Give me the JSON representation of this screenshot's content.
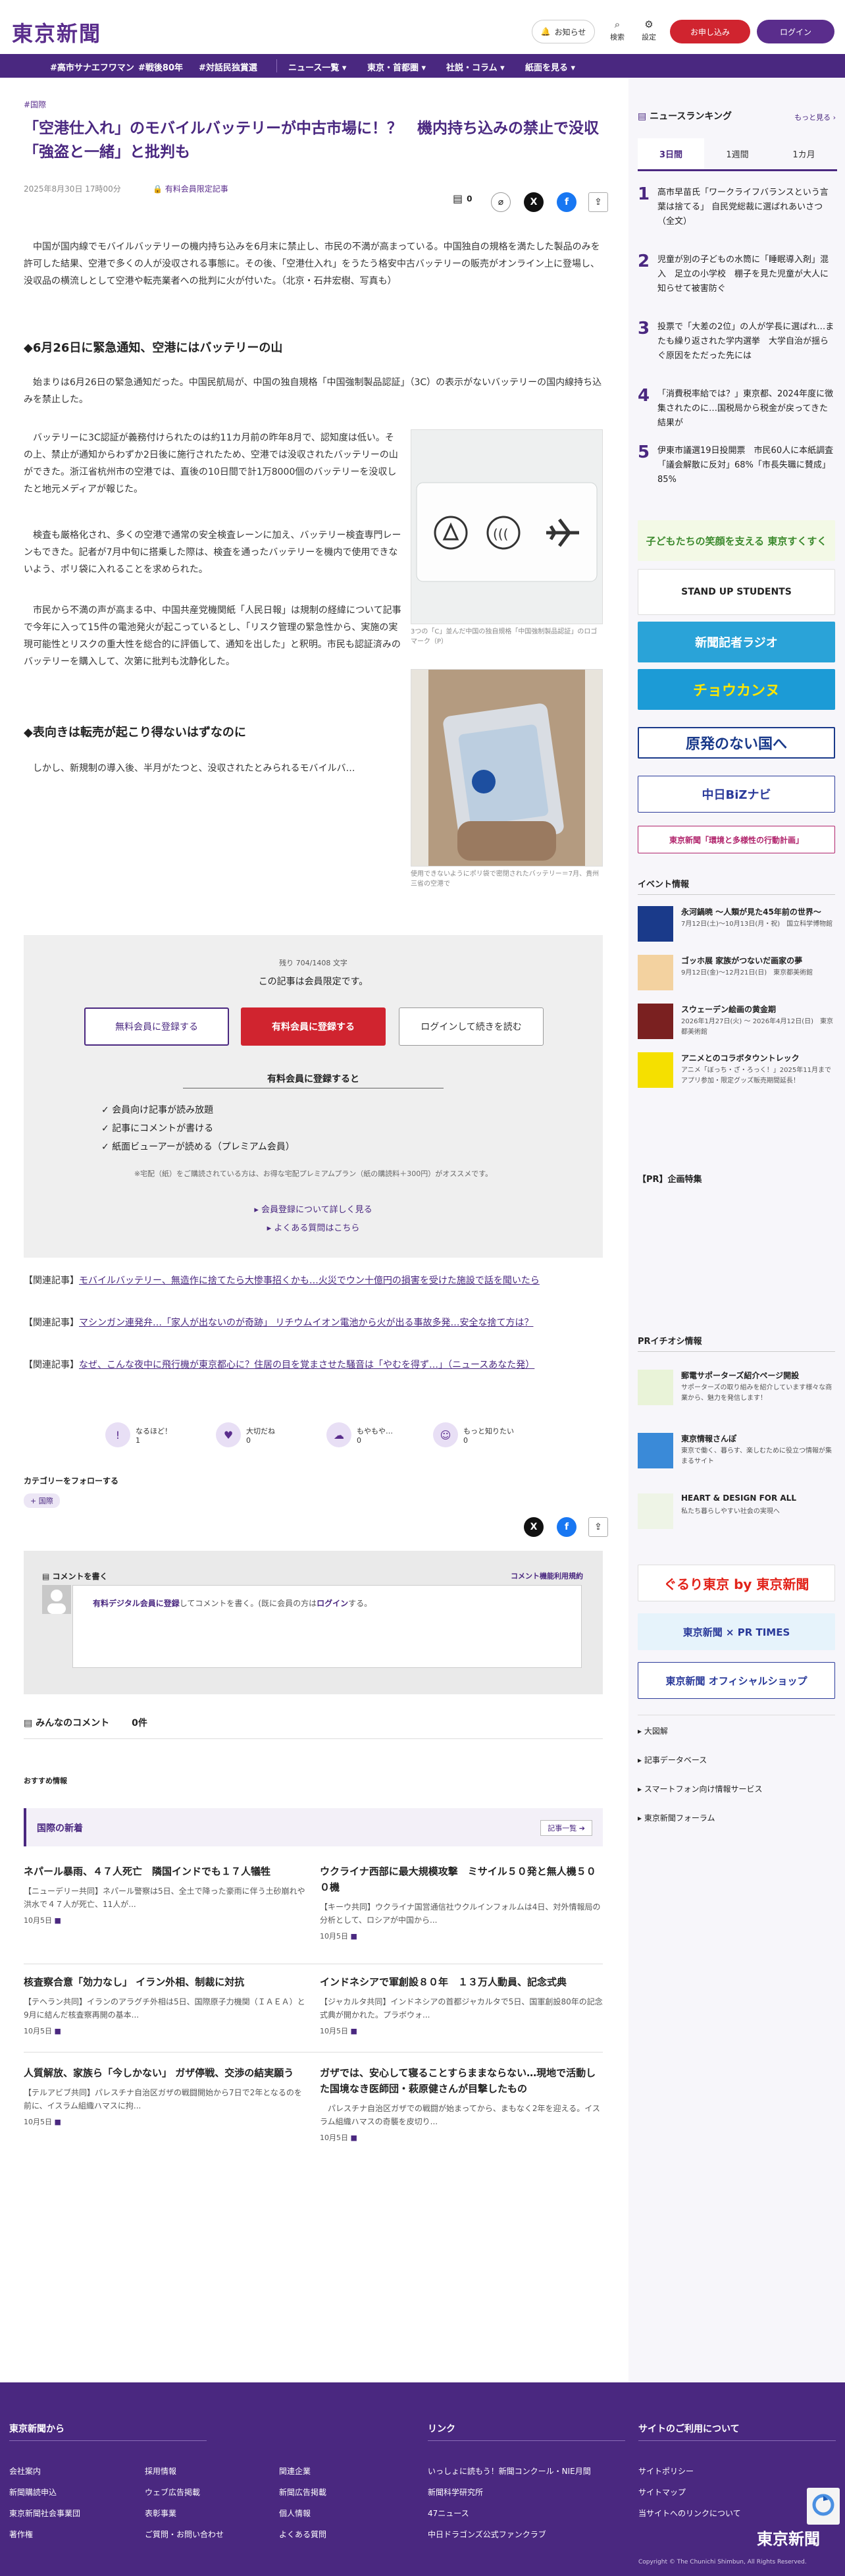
{
  "header": {
    "logo": "東京新聞",
    "notif": "お知らせ",
    "search": "検索",
    "settings": "設定",
    "register": "お申し込み",
    "login": "ログイン"
  },
  "nav": [
    "#高市サナエフワマン",
    "#戦後80年",
    "#対話民独賞選",
    "ニュース一覧 ▾",
    "東京・首都圏 ▾",
    "社説・コラム ▾",
    "紙面を見る ▾"
  ],
  "article": {
    "category": "#国際",
    "title": "「空港仕入れ」のモバイルバッテリーが中古市場に！？　機内持ち込みの禁止で没収　「強盗と一緒」と批判も",
    "date": "2025年8月30日 17時00分",
    "paid": "有料会員限定記事",
    "comment_count": "0",
    "p1": "　中国が国内線でモバイルバッテリーの機内持ち込みを6月末に禁止し、市民の不満が高まっている。中国独自の規格を満たした製品のみを許可した結果、空港で多くの人が没収される事態に。その後、「空港仕入れ」をうたう格安中古バッテリーの販売がオンライン上に登場し、没収品の横流しとして空港や転売業者への批判に火が付いた。（北京・石井宏樹、写真も）",
    "h1": "◆6月26日に緊急通知、空港にはバッテリーの山",
    "p2": "　始まりは6月26日の緊急通知だった。中国民航局が、中国の独自規格「中国強制製品認証」（3C）の表示がないバッテリーの国内線持ち込みを禁止した。",
    "p3": "　バッテリーに3C認証が義務付けられたのは約11カ月前の昨年8月で、認知度は低い。その上、禁止が通知からわずか2日後に施行されたため、空港では没収されたバッテリーの山ができた。浙江省杭州市の空港では、直後の10日間で計1万8000個のバッテリーを没収したと地元メディアが報じた。",
    "p4": "　検査も厳格化され、多くの空港で通常の安全検査レーンに加え、バッテリー検査専門レーンもできた。記者が7月中旬に搭乗した際は、検査を通ったバッテリーを機内で使用できないよう、ポリ袋に入れることを求められた。",
    "p5": "　市民から不満の声が高まる中、中国共産党機関紙「人民日報」は規制の経緯について記事で今年に入って15件の電池発火が起こっているとし、「リスク管理の緊急性から、実施の実現可能性とリスクの重大性を総合的に評価して、通知を出した」と釈明。市民も認証済みのバッテリーを購入して、次第に批判も沈静化した。",
    "h2": "◆表向きは転売が起こり得ないはずなのに",
    "p6": "　しかし、新規制の導入後、半月がたつと、没収されたとみられるモバイルバ…",
    "cap1": "3つの「C」並んだ中国の独自規格「中国強制製品認証」のロゴマーク（P）",
    "cap2": "使用できないようにポリ袋で密閉されたバッテリー＝7月、貴州三省の空港で"
  },
  "paywall": {
    "remain": "残り 704/1408 文字",
    "lead": "この記事は会員限定です。",
    "free": "無料会員に登録する",
    "paid": "有料会員に登録する",
    "login": "ログインして続きを読む",
    "benefit_title": "有料会員に登録すると",
    "benefits": [
      "会員向け記事が読み放題",
      "記事にコメントが書ける",
      "紙面ビューアーが読める（プレミアム会員）"
    ],
    "note": "※宅配（紙）をご購読されている方は、お得な宅配プレミアムプラン（紙の購読料＋300円）がオススメです。",
    "more1": "会員登録について詳しく見る",
    "more2": "よくある質問はこちら"
  },
  "related": [
    {
      "label": "【関連記事】",
      "text": "モバイルバッテリー、無造作に捨てたら大惨事招くかも…火災でウン十億円の損害を受けた施設で話を聞いたら"
    },
    {
      "label": "【関連記事】",
      "text": "マシンガン連発弁…「家人が出ないのが奇跡」 リチウムイオン電池から火が出る事故多発…安全な捨て方は？"
    },
    {
      "label": "【関連記事】",
      "text": "なぜ、こんな夜中に飛行機が東京都心に？住居の目を覚まさせた騒音は「やむを得ず…」（ニュースあなた発）"
    }
  ],
  "reactions": [
    {
      "label": "なるほど！",
      "count": "1"
    },
    {
      "label": "大切だね",
      "count": "0"
    },
    {
      "label": "もやもや…",
      "count": "0"
    },
    {
      "label": "もっと知りたい",
      "count": "0"
    }
  ],
  "follow": {
    "title": "カテゴリーをフォローする",
    "tag": "国際"
  },
  "comment": {
    "write": "コメントを書く",
    "rule": "コメント機能利用規約",
    "prompt_link": "有料デジタル会員に登録",
    "prompt_mid": "してコメントを書く。(既に会員の方は",
    "prompt_login": "ログイン",
    "prompt_end": "する。",
    "all": "みんなのコメント",
    "count": "0件"
  },
  "recommend": {
    "label": "おすすめ情報",
    "section": "国際の新着",
    "more": "記事一覧",
    "items": [
      {
        "t": "ネパール暴雨、４７人死亡　隣国インドでも１７人犠牲",
        "d": "【ニューデリー共同】ネパール警察は5日、全土で降った豪雨に伴う土砂崩れや洪水で４７人が死亡、11人が...",
        "dt": "10月5日"
      },
      {
        "t": "ウクライナ西部に最大規模攻撃　ミサイル５０発と無人機５００機",
        "d": "【キーウ共同】ウクライナ国営通信社ウクルインフォルムは4日、対外情報局の分析として、ロシアが中国から...",
        "dt": "10月5日"
      },
      {
        "t": "核査察合意「効力なし」 イラン外相、制裁に対抗",
        "d": "【テヘラン共同】イランのアラグチ外相は5日、国際原子力機関（ＩＡＥＡ）と9月に結んだ核査察再開の基本...",
        "dt": "10月5日"
      },
      {
        "t": "インドネシアで軍創設８０年　１３万人動員、記念式典",
        "d": "【ジャカルタ共同】インドネシアの首都ジャカルタで5日、国軍創設80年の記念式典が開かれた。プラボウォ...",
        "dt": "10月5日"
      },
      {
        "t": "人質解放、家族ら「今しかない」 ガザ停戦、交渉の結実願う",
        "d": "【テルアビブ共同】パレスチナ自治区ガザの戦闘開始から7日で2年となるのを前に、イスラム組織ハマスに拘...",
        "dt": "10月5日"
      },
      {
        "t": "ガザでは、安心して寝ることすらままならない…現地で活動した国境なき医師団・萩原健さんが目撃したもの",
        "d": "　パレスチナ自治区ガザでの戦闘が始まってから、まもなく2年を迎える。イスラム組織ハマスの奇襲を皮切り...",
        "dt": "10月5日"
      }
    ]
  },
  "sidebar": {
    "ranking_title": "ニュースランキング",
    "ranking_more": "もっと見る",
    "tabs": [
      "3日間",
      "1週間",
      "1カ月"
    ],
    "ranking": [
      {
        "n": "1",
        "t": "高市早苗氏「ワークライフバランスという言葉は捨てる」 自民党総裁に選ばれあいさつ（全文）"
      },
      {
        "n": "2",
        "t": "児童が別の子どもの水筒に「睡眠導入剤」混入　足立の小学校　棚子を見た児童が大人に知らせて被害防ぐ"
      },
      {
        "n": "3",
        "t": "投票で「大差の2位」の人が学長に選ばれ…またも繰り返された学内選挙　大学自治が揺らぐ原因をただった先には"
      },
      {
        "n": "4",
        "t": "「消費税率給では？」東京都、2024年度に徴集されたのに…国税局から税金が戻ってきた結果が"
      },
      {
        "n": "5",
        "t": "伊東市議選19日投開票　市民60人に本紙調査「議会解散に反対」68%「市長失職に賛成」85%"
      }
    ],
    "banners": [
      {
        "text": "子どもたちの笑顔を支える 東京すくすく",
        "bg": "#f3f9e6",
        "fg": "#3c8a2e"
      },
      {
        "text": "STAND UP STUDENTS",
        "bg": "#ffffff",
        "fg": "#222222"
      },
      {
        "text": "新聞記者ラジオ",
        "bg": "#2aa3d8",
        "fg": "#ffffff"
      },
      {
        "text": "チョウカンヌ",
        "bg": "#1c9bd6",
        "fg": "#ffe600"
      },
      {
        "text": "原発のない国へ",
        "bg": "#ffffff",
        "fg": "#1a3a8a"
      },
      {
        "text": "中日BiZナビ",
        "bg": "#ffffff",
        "fg": "#2a3a9a"
      },
      {
        "text": "東京新聞「環境と多様性の行動計画」",
        "bg": "#ffffff",
        "fg": "#b0236b"
      }
    ],
    "events_title": "イベント情報",
    "events": [
      {
        "t": "永河鍋暁 ～人類が見た45年前の世界～",
        "d": "7月12日(土)～10月13日(月・祝)　国立科学博物館",
        "c": "#1a3a8a"
      },
      {
        "t": "ゴッホ展 家族がつないだ画家の夢",
        "d": "9月12日(金)～12月21日(日)　東京都美術館",
        "c": "#f3d2a0"
      },
      {
        "t": "スウェーデン絵画の黄金期",
        "d": "2026年1月27日(火) ～ 2026年4月12日(日)　東京都美術館",
        "c": "#7a2020"
      },
      {
        "t": "アニメとのコラボタウントレック",
        "d": "アニメ「ぼっち・ざ・ろっく！」2025年11月までアプリ参加・限定グッズ販売期間延長！",
        "c": "#f5e000"
      }
    ],
    "pr_title": "【PR】企画特集",
    "prevent_title": "PRイチオシ情報",
    "prevents": [
      {
        "t": "郵電サポーターズ紹介ページ開設",
        "d": "サポーターズの取り組みを紹介しています様々な商業から、魅力を発信します！",
        "c": "#e9f3d8"
      },
      {
        "t": "東京情報さんぽ",
        "d": "東京で働く、暮らす、楽しむために役立つ情報が集まるサイト",
        "c": "#3a8ad8"
      },
      {
        "t": "HEART & DESIGN FOR ALL",
        "d": "私たち暮らしやすい社会の実現へ",
        "c": "#eef4e6"
      }
    ],
    "banners2": [
      {
        "text": "ぐるり東京 by 東京新聞",
        "bg": "#ffffff",
        "fg": "#e2231a"
      },
      {
        "text": "東京新聞 × PR TIMES",
        "bg": "#e6f3fb",
        "fg": "#2a3a9a"
      },
      {
        "text": "東京新聞 オフィシャルショップ",
        "bg": "#ffffff",
        "fg": "#2a3a9a"
      }
    ],
    "links": [
      "大図解",
      "記事データベース",
      "スマートフォン向け情報サービス",
      "東京新聞フォーラム"
    ]
  },
  "footer": {
    "col1_title": "東京新聞から",
    "col1": [
      "会社案内",
      "新聞購読申込",
      "東京新聞社会事業団",
      "著作権",
      "採用情報",
      "ウェブ広告掲載",
      "表彰事業",
      "ご質問・お問い合わせ",
      "関連企業",
      "新聞広告掲載",
      "個人情報",
      "よくある質問"
    ],
    "col2_title": "リンク",
    "col2": [
      "いっしょに読もう！新聞コンクール・NIE月間",
      "新聞科学研究所",
      "47ニュース",
      "中日ドラゴンズ公式ファンクラブ"
    ],
    "col3_title": "サイトのご利用について",
    "col3": [
      "サイトポリシー",
      "サイトマップ",
      "当サイトへのリンクについて"
    ],
    "logo": "東京新聞",
    "copyright": "Copyright © The Chunichi Shimbun, All Rights Reserved."
  }
}
